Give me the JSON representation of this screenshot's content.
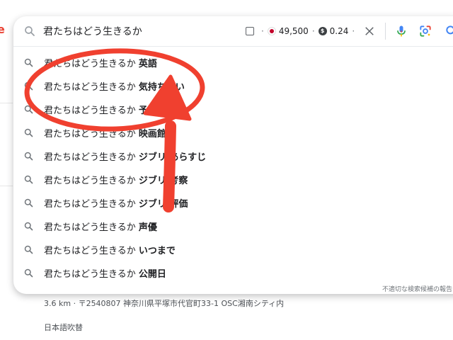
{
  "query": "君たちはどう生きるか",
  "extension": {
    "stat1": "49,500",
    "stat2": "0.24"
  },
  "suggestions": [
    {
      "prefix": "君たちはどう生きるか",
      "suffix": "英語"
    },
    {
      "prefix": "君たちはどう生きるか",
      "suffix": "気持ち悪い"
    },
    {
      "prefix": "君たちはどう生きるか",
      "suffix": "予告"
    },
    {
      "prefix": "君たちはどう生きるか",
      "suffix": "映画館"
    },
    {
      "prefix": "君たちはどう生きるか",
      "suffix": "ジブリ あらすじ"
    },
    {
      "prefix": "君たちはどう生きるか",
      "suffix": "ジブリ 考察"
    },
    {
      "prefix": "君たちはどう生きるか",
      "suffix": "ジブリ 評価"
    },
    {
      "prefix": "君たちはどう生きるか",
      "suffix": "声優"
    },
    {
      "prefix": "君たちはどう生きるか",
      "suffix": "いつまで"
    },
    {
      "prefix": "君たちはどう生きるか",
      "suffix": "公開日"
    }
  ],
  "report_link": "不適切な検索候補の報告",
  "background": {
    "address": "3.6 km · 〒2540807 神奈川県平塚市代官町33-1 OSC湘南シティ内",
    "language": "日本語吹替"
  },
  "colors": {
    "annotation": "#f0402f",
    "suggestion_icon": "#70757a"
  }
}
